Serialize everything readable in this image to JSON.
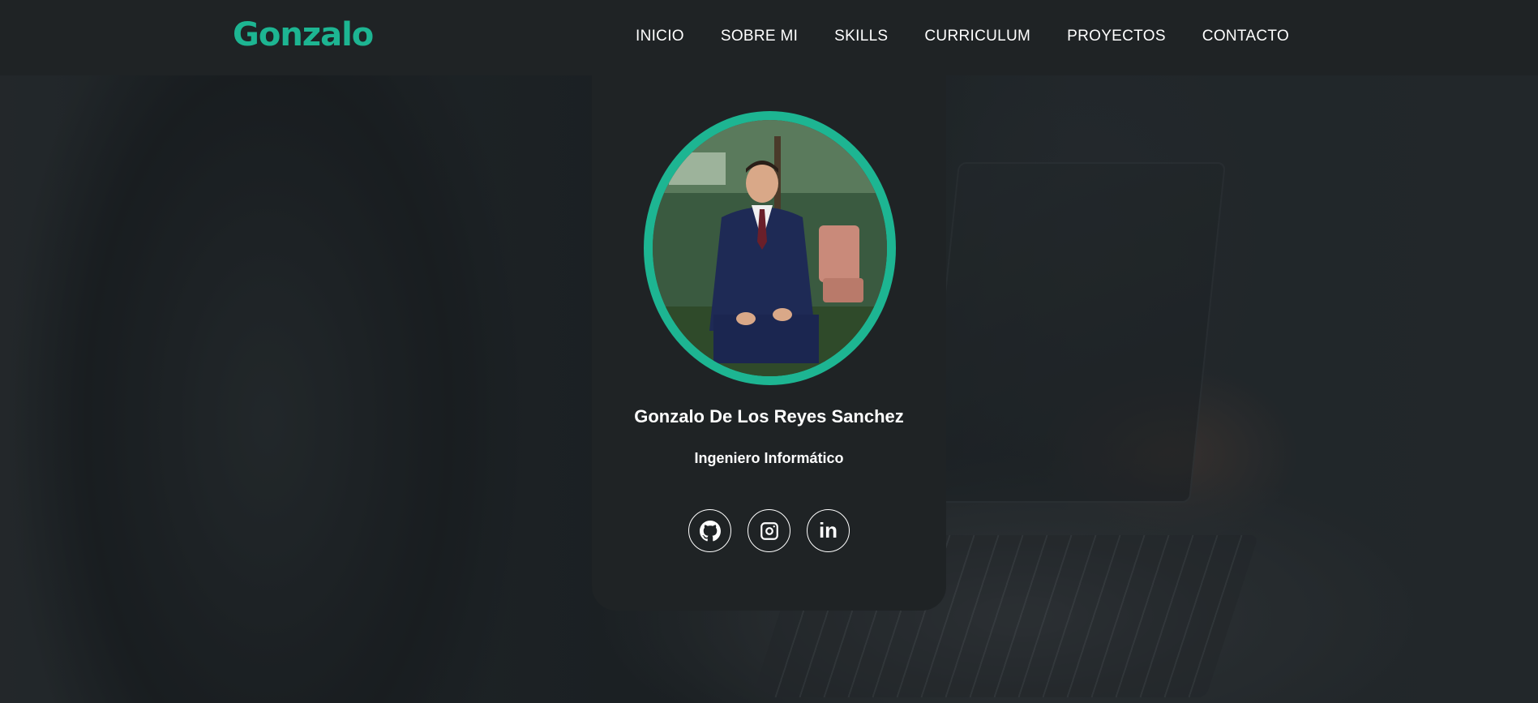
{
  "header": {
    "logo": "Gonzalo",
    "nav": [
      {
        "label": "INICIO"
      },
      {
        "label": "SOBRE MI"
      },
      {
        "label": "SKILLS"
      },
      {
        "label": "CURRICULUM"
      },
      {
        "label": "PROYECTOS"
      },
      {
        "label": "CONTACTO"
      }
    ]
  },
  "profile": {
    "name": "Gonzalo De Los Reyes Sanchez",
    "role": "Ingeniero Informático",
    "socials": [
      {
        "icon": "github-icon"
      },
      {
        "icon": "instagram-icon"
      },
      {
        "icon": "linkedin-icon",
        "glyph": "in"
      }
    ]
  },
  "colors": {
    "accent": "#1db592",
    "background": "#1f2325",
    "text": "#ffffff"
  }
}
